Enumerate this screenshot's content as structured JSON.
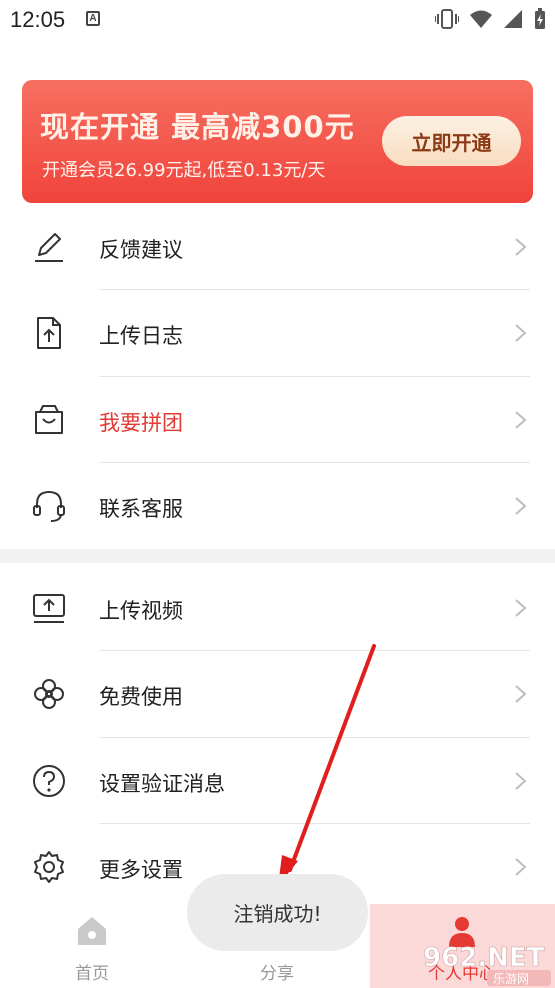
{
  "status_bar": {
    "time": "12:05",
    "notification_icon_letter": "A"
  },
  "vip_banner": {
    "title": "现在开通 最高减300元",
    "subtitle": "开通会员26.99元起,低至0.13元/天",
    "button_label": "立即开通"
  },
  "menu": {
    "group1": [
      {
        "label": "反馈建议",
        "icon": "pencil-icon"
      },
      {
        "label": "上传日志",
        "icon": "file-upload-icon"
      },
      {
        "label": "我要拼团",
        "icon": "shopping-bag-icon",
        "highlight_color": "#e53935"
      },
      {
        "label": "联系客服",
        "icon": "headset-icon"
      }
    ],
    "group2": [
      {
        "label": "上传视频",
        "icon": "video-upload-icon"
      },
      {
        "label": "免费使用",
        "icon": "flower-icon"
      },
      {
        "label": "设置验证消息",
        "icon": "question-icon"
      },
      {
        "label": "更多设置",
        "icon": "gear-icon"
      }
    ]
  },
  "bottom_nav": {
    "items": [
      {
        "label": "首页",
        "icon": "home-icon"
      },
      {
        "label": "分享",
        "icon": "share-icon"
      },
      {
        "label": "个人中心",
        "icon": "person-icon",
        "active": true
      }
    ]
  },
  "toast": {
    "message": "注销成功!"
  },
  "watermark": {
    "text": "962.NET 乐游网"
  },
  "colors": {
    "accent_red": "#e53935",
    "banner_gradient_top": "#f76f60",
    "banner_gradient_bottom": "#f0433c",
    "toast_bg": "#ebebeb"
  }
}
